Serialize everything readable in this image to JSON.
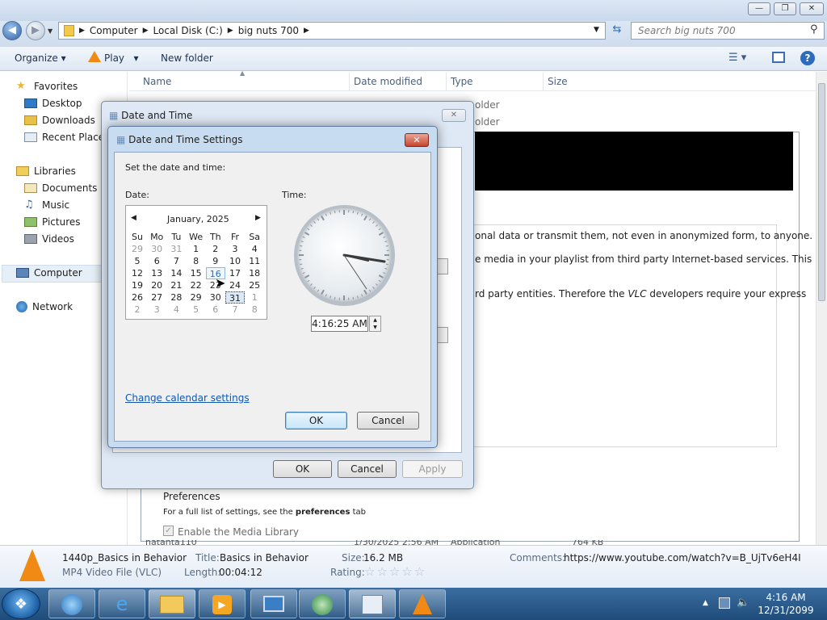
{
  "window": {
    "address_crumbs": [
      "Computer",
      "Local Disk (C:)",
      "big nuts 700"
    ],
    "search_placeholder": "Search big nuts 700"
  },
  "toolbar": {
    "organize": "Organize",
    "play": "Play",
    "new_folder": "New folder"
  },
  "nav": {
    "favorites": "Favorites",
    "desktop": "Desktop",
    "downloads": "Downloads",
    "recent": "Recent Places",
    "libraries": "Libraries",
    "documents": "Documents",
    "music": "Music",
    "pictures": "Pictures",
    "videos": "Videos",
    "computer": "Computer",
    "network": "Network"
  },
  "columns": {
    "name": "Name",
    "date": "Date modified",
    "type": "Type",
    "size": "Size"
  },
  "file_rows": [
    {
      "type": "older"
    },
    {
      "type": "older"
    }
  ],
  "bottom_row": {
    "name": "natanta110",
    "date": "1/30/2025 2:56 AM",
    "type": "Application",
    "size": "764 KB"
  },
  "vlc": {
    "line1": "onal data or transmit them, not even in anonymized form, to anyone.",
    "line2": "e media in your playlist from third party Internet-based services. This",
    "line3a": "rd party entities. Therefore the ",
    "line3b": "VLC",
    "line3c": " developers require your express",
    "prefs_title": "Preferences",
    "prefs_note_a": "For a full list of settings, see the ",
    "prefs_note_b": "preferences",
    "prefs_note_c": " tab",
    "media_lib": "Enable the Media Library"
  },
  "details": {
    "filename": "1440p_Basics in Behavior",
    "filetype": "MP4 Video File (VLC)",
    "title_key": "Title:",
    "title_val": "Basics in Behavior",
    "length_key": "Length:",
    "length_val": "00:04:12",
    "size_key": "Size:",
    "size_val": "16.2 MB",
    "rating_key": "Rating:",
    "comments_key": "Comments:",
    "comments_val": "https://www.youtube.com/watch?v=B_UjTv6eH4I"
  },
  "dt_outer": {
    "title": "Date and Time",
    "ok": "OK",
    "cancel": "Cancel",
    "apply": "Apply"
  },
  "dts": {
    "title": "Date and Time Settings",
    "prompt": "Set the date and time:",
    "date_label": "Date:",
    "time_label": "Time:",
    "month": "January, 2025",
    "weekdays": [
      "Su",
      "Mo",
      "Tu",
      "We",
      "Th",
      "Fr",
      "Sa"
    ],
    "weeks": [
      [
        "29",
        "30",
        "31",
        "1",
        "2",
        "3",
        "4"
      ],
      [
        "5",
        "6",
        "7",
        "8",
        "9",
        "10",
        "11"
      ],
      [
        "12",
        "13",
        "14",
        "15",
        "16",
        "17",
        "18"
      ],
      [
        "19",
        "20",
        "21",
        "22",
        "23",
        "24",
        "25"
      ],
      [
        "26",
        "27",
        "28",
        "29",
        "30",
        "31",
        "1"
      ],
      [
        "2",
        "3",
        "4",
        "5",
        "6",
        "7",
        "8"
      ]
    ],
    "time": "4:16:25 AM",
    "change_link": "Change calendar settings",
    "ok": "OK",
    "cancel": "Cancel"
  },
  "clock": {
    "time": "4:16 AM",
    "date": "12/31/2099"
  }
}
